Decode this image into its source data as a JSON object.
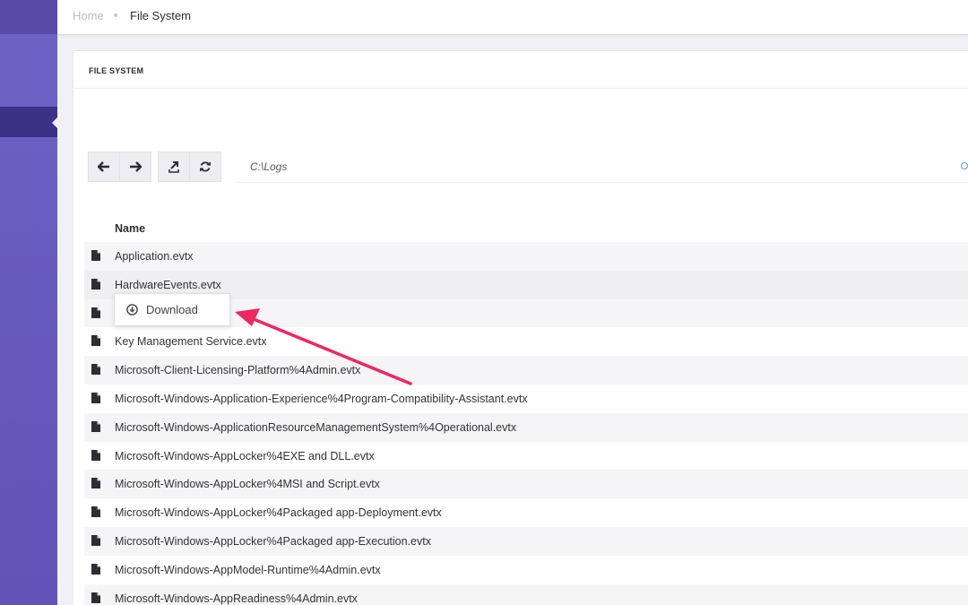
{
  "breadcrumb": {
    "home": "Home",
    "current": "File System"
  },
  "card": {
    "title": "FILE SYSTEM"
  },
  "toolbar": {
    "back_icon": "arrow-left-icon",
    "forward_icon": "arrow-right-icon",
    "upload_icon": "upload-icon",
    "refresh_icon": "refresh-icon"
  },
  "path": {
    "value": "C:\\Logs"
  },
  "table": {
    "column_name": "Name",
    "files": [
      {
        "name": "Application.evtx"
      },
      {
        "name": "HardwareEvents.evtx"
      },
      {
        "name": ""
      },
      {
        "name": "Key Management Service.evtx"
      },
      {
        "name": "Microsoft-Client-Licensing-Platform%4Admin.evtx"
      },
      {
        "name": "Microsoft-Windows-Application-Experience%4Program-Compatibility-Assistant.evtx"
      },
      {
        "name": "Microsoft-Windows-ApplicationResourceManagementSystem%4Operational.evtx"
      },
      {
        "name": "Microsoft-Windows-AppLocker%4EXE and DLL.evtx"
      },
      {
        "name": "Microsoft-Windows-AppLocker%4MSI and Script.evtx"
      },
      {
        "name": "Microsoft-Windows-AppLocker%4Packaged app-Deployment.evtx"
      },
      {
        "name": "Microsoft-Windows-AppLocker%4Packaged app-Execution.evtx"
      },
      {
        "name": "Microsoft-Windows-AppModel-Runtime%4Admin.evtx"
      },
      {
        "name": "Microsoft-Windows-AppReadiness%4Admin.evtx"
      }
    ]
  },
  "context_menu": {
    "download_label": "Download",
    "download_icon": "download-circle-icon"
  },
  "colors": {
    "sidebar": "#6a5bc0",
    "sidebar_active": "#3b3187",
    "annotation_arrow": "#f0265f"
  }
}
